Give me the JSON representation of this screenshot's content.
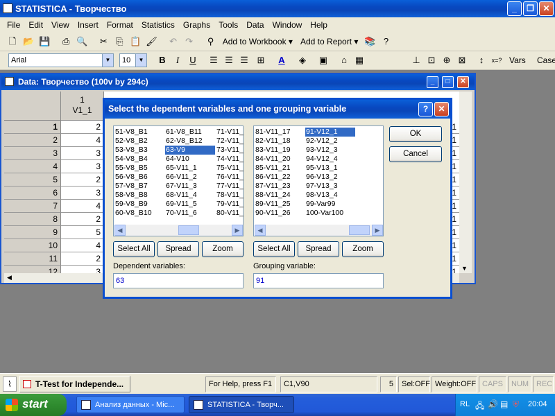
{
  "app": {
    "title": "STATISTICA - Творчество"
  },
  "menu": [
    "File",
    "Edit",
    "View",
    "Insert",
    "Format",
    "Statistics",
    "Graphs",
    "Tools",
    "Data",
    "Window",
    "Help"
  ],
  "toolbar1": {
    "add_to_workbook": "Add to Workbook",
    "add_to_report": "Add to Report"
  },
  "toolbar2": {
    "font": "Arial",
    "size": "10",
    "bold": "B",
    "italic": "I",
    "underline": "U",
    "vars": "Vars",
    "cases": "Case"
  },
  "datawin": {
    "title": "Data: Творчество (100v by 294c)",
    "col_header_num": "1",
    "col_header_name": "V1_1",
    "rows": [
      {
        "n": "1",
        "v": "2"
      },
      {
        "n": "2",
        "v": "4"
      },
      {
        "n": "3",
        "v": "3"
      },
      {
        "n": "4",
        "v": "3"
      },
      {
        "n": "5",
        "v": "2"
      },
      {
        "n": "6",
        "v": "3"
      },
      {
        "n": "7",
        "v": "4"
      },
      {
        "n": "8",
        "v": "2"
      },
      {
        "n": "9",
        "v": "5"
      },
      {
        "n": "10",
        "v": "4"
      },
      {
        "n": "11",
        "v": "2"
      },
      {
        "n": "12",
        "v": "3"
      }
    ],
    "right_col": [
      "1",
      "1",
      "1",
      "1",
      "1",
      "1",
      "1",
      "1",
      "1",
      "1",
      "1",
      "1"
    ]
  },
  "dialog": {
    "title": "Select the dependent variables and one grouping variable",
    "left_list": [
      [
        "51-V8_B1",
        "52-V8_B2",
        "53-V8_B3",
        "54-V8_B4",
        "55-V8_B5",
        "56-V8_B6",
        "57-V8_B7",
        "58-V8_B8",
        "59-V8_B9",
        "60-V8_B10"
      ],
      [
        "61-V8_B11",
        "62-V8_B12",
        "63-V9",
        "64-V10",
        "65-V11_1",
        "66-V11_2",
        "67-V11_3",
        "68-V11_4",
        "69-V11_5",
        "70-V11_6"
      ],
      [
        "71-V11_",
        "72-V11_",
        "73-V11_",
        "74-V11_",
        "75-V11_",
        "76-V11_",
        "77-V11_",
        "78-V11_",
        "79-V11_",
        "80-V11_"
      ]
    ],
    "right_list": [
      [
        "81-V11_17",
        "82-V11_18",
        "83-V11_19",
        "84-V11_20",
        "85-V11_21",
        "86-V11_22",
        "87-V11_23",
        "88-V11_24",
        "89-V11_25",
        "90-V11_26"
      ],
      [
        "91-V12_1",
        "92-V12_2",
        "93-V12_3",
        "94-V12_4",
        "95-V13_1",
        "96-V13_2",
        "97-V13_3",
        "98-V13_4",
        "99-Var99",
        "100-Var100"
      ]
    ],
    "select_all": "Select All",
    "spread": "Spread",
    "zoom": "Zoom",
    "ok": "OK",
    "cancel": "Cancel",
    "dependent_label": "Dependent variables:",
    "dependent_value": "63",
    "grouping_label": "Grouping variable:",
    "grouping_value": "91"
  },
  "statusbar": {
    "task": "T-Test for Independe...",
    "help": "For Help, press F1",
    "cell": "C1,V90",
    "num": "5",
    "sel": "Sel:OFF",
    "weight": "Weight:OFF",
    "caps": "CAPS",
    "numlock": "NUM",
    "rec": "REC"
  },
  "taskbar": {
    "start": "start",
    "task1": "Анализ данных - Mic...",
    "task2": "STATISTICA - Творч...",
    "lang": "RL",
    "time": "20:04"
  },
  "colors": {
    "xp_blue": "#0a46b8",
    "selection": "#316ac5",
    "taskbar": "#245edb",
    "start_green": "#2f8c2f"
  }
}
